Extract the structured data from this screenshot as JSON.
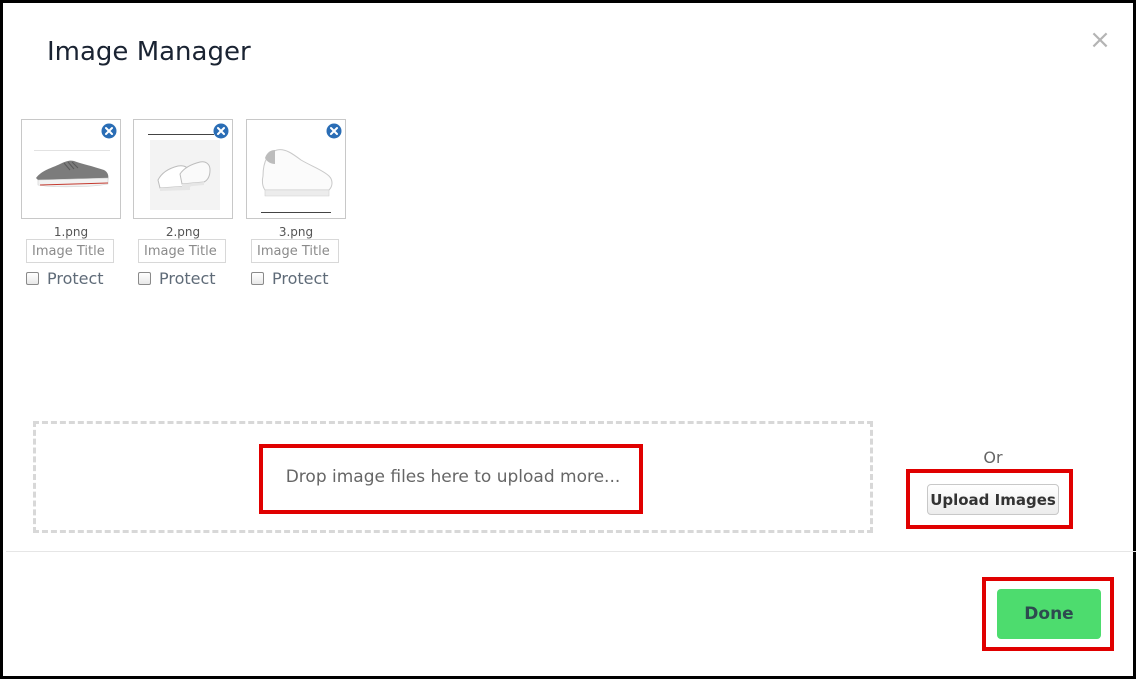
{
  "dialog": {
    "title": "Image Manager",
    "close_symbol": "×"
  },
  "images": [
    {
      "filename": "1.png",
      "title_placeholder": "Image Title",
      "protect_label": "Protect",
      "protected": false,
      "icon": "gray-sneaker-image"
    },
    {
      "filename": "2.png",
      "title_placeholder": "Image Title",
      "protect_label": "Protect",
      "protected": false,
      "icon": "white-sneakers-pair-image"
    },
    {
      "filename": "3.png",
      "title_placeholder": "Image Title",
      "protect_label": "Protect",
      "protected": false,
      "icon": "white-sneaker-image"
    }
  ],
  "dropzone": {
    "text": "Drop image files here to upload more..."
  },
  "upload": {
    "or_label": "Or",
    "button_label": "Upload Images"
  },
  "footer": {
    "done_label": "Done"
  },
  "colors": {
    "highlight": "#e00000",
    "done_button": "#4ddc6e",
    "remove_icon": "#2a6db5"
  }
}
